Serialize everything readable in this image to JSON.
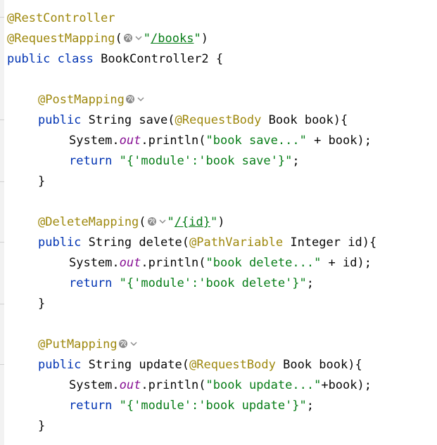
{
  "code": {
    "ann_rest_controller": "@RestController",
    "ann_request_mapping": "@RequestMapping",
    "path_books": "/books",
    "kw_public": "public",
    "kw_class": "class",
    "class_name": "BookController2",
    "ann_post_mapping": "@PostMapping",
    "type_string": "String",
    "method_save": "save",
    "ann_request_body": "@RequestBody",
    "type_book": "Book",
    "param_book": "book",
    "system": "System",
    "out": "out",
    "println": "println",
    "str_book_save": "\"book save...\"",
    "kw_return": "return",
    "str_module_save": "\"{'module':'book save'}\"",
    "ann_delete_mapping": "@DeleteMapping",
    "path_id": "/{id}",
    "method_delete": "delete",
    "ann_path_variable": "@PathVariable",
    "type_integer": "Integer",
    "param_id": "id",
    "str_book_delete": "\"book delete...\"",
    "str_module_delete": "\"{'module':'book delete'}\"",
    "ann_put_mapping": "@PutMapping",
    "method_update": "update",
    "str_book_update": "\"book update...\"",
    "str_module_update": "\"{'module':'book update'}\""
  },
  "icons": {
    "endpoint_icon": "globe-icon",
    "dropdown_icon": "chevron-down-icon"
  },
  "colors": {
    "keyword": "#0033b3",
    "annotation": "#9e880d",
    "string": "#067d17",
    "static_field": "#871094",
    "text": "#080808",
    "background": "#ffffff"
  }
}
